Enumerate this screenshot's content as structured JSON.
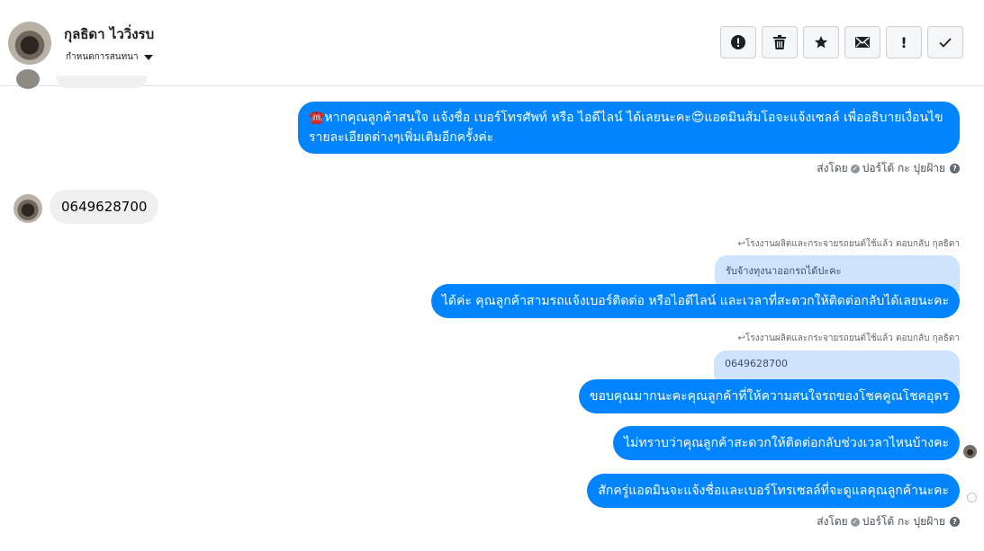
{
  "header": {
    "contact_name": "กุลธิดา ไววิ่งรบ",
    "assign_label": "กำหนดการสนทนา",
    "toolbar": {
      "icons": [
        "alert-icon",
        "trash-icon",
        "star-icon",
        "envelope-icon",
        "exclamation-icon",
        "check-icon"
      ],
      "exclamation_glyph": "!"
    }
  },
  "messages": {
    "m1": {
      "text": "☎️หากคุณลูกค้าสนใจ แจ้งชื่อ เบอร์โทรศัพท์ หรือ ไอดีไลน์  ได้เลยนะคะ😍แอดมินส้มโอจะแจ้งเซลล์   เพื่ออธิบายเงื่อนไขรายละเอียดต่างๆเพิ่มเติมอีกครั้งค่ะ",
      "meta_prefix": "ส่งโดย",
      "meta_author": "ปอร์โต้ กะ ปุยฝ้าย"
    },
    "m2": {
      "text": "0649628700"
    },
    "r1": {
      "reply_hint": "โรงงานผลิตและกระจายรถยนต์ใช้แล้ว ตอบกลับ กุลธิดา",
      "quoted": "รับจ้างทุงนาออกรถได้ปะคะ",
      "text": "ได้ค่ะ คุณลูกค้าสามรถแจ้งเบอร์ติดต่อ หรือไอดีไลน์ และเวลาที่สะดวกให้ติดต่อกลับได้เลยนะคะ"
    },
    "r2": {
      "reply_hint": "โรงงานผลิตและกระจายรถยนต์ใช้แล้ว ตอบกลับ กุลธิดา",
      "quoted": "0649628700",
      "text": "ขอบคุณมากนะคะคุณลูกค้าที่ให้ความสนใจรถของโชคคูณโชคอุดร"
    },
    "m3": {
      "text": "ไม่ทราบว่าคุณลูกค้าสะดวกให้ติดต่อกลับช่วงเวลาไหนบ้างคะ"
    },
    "m4": {
      "text": "สักครู่แอดมินจะแจ้งชื่อและเบอร์โทรเซลล์ที่จะดูแลคุณลูกค้านะคะ",
      "meta_prefix": "ส่งโดย",
      "meta_author": "ปอร์โต้ กะ ปุยฝ้าย"
    }
  },
  "colors": {
    "outgoing": "#0084ff",
    "incoming": "#f0f0f0",
    "quoted": "#cfe3fd"
  }
}
